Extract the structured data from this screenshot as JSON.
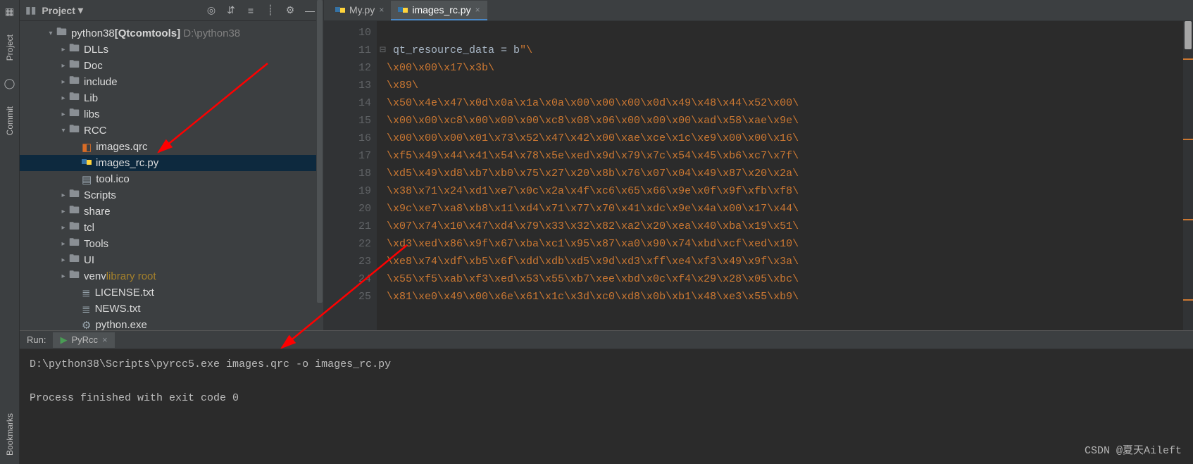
{
  "leftRail": {
    "project": "Project",
    "commit": "Commit",
    "bookmarks": "Bookmarks"
  },
  "toolbar": {
    "menuLabel": "Project",
    "icons": [
      "target-icon",
      "collapse-icon",
      "expand-icon",
      "divider",
      "settings-icon",
      "minimize-icon"
    ]
  },
  "project": {
    "root": {
      "name": "python38",
      "suffix": "[Qtcomtools]",
      "path": "D:\\python38"
    },
    "nodes": [
      {
        "indent": 1,
        "tw": "v",
        "kind": "folder",
        "name": "python38",
        "suffix": "[Qtcomtools]",
        "muted": "D:\\python38"
      },
      {
        "indent": 2,
        "tw": ">",
        "kind": "folder",
        "name": "DLLs"
      },
      {
        "indent": 2,
        "tw": ">",
        "kind": "folder",
        "name": "Doc"
      },
      {
        "indent": 2,
        "tw": ">",
        "kind": "folder",
        "name": "include"
      },
      {
        "indent": 2,
        "tw": ">",
        "kind": "folder",
        "name": "Lib"
      },
      {
        "indent": 2,
        "tw": ">",
        "kind": "folder",
        "name": "libs"
      },
      {
        "indent": 2,
        "tw": "v",
        "kind": "folder",
        "name": "RCC"
      },
      {
        "indent": 3,
        "tw": "",
        "kind": "qrc",
        "name": "images.qrc"
      },
      {
        "indent": 3,
        "tw": "",
        "kind": "py",
        "name": "images_rc.py",
        "selected": true
      },
      {
        "indent": 3,
        "tw": "",
        "kind": "ico",
        "name": "tool.ico"
      },
      {
        "indent": 2,
        "tw": ">",
        "kind": "folder",
        "name": "Scripts"
      },
      {
        "indent": 2,
        "tw": ">",
        "kind": "folder",
        "name": "share"
      },
      {
        "indent": 2,
        "tw": ">",
        "kind": "folder",
        "name": "tcl"
      },
      {
        "indent": 2,
        "tw": ">",
        "kind": "folder",
        "name": "Tools"
      },
      {
        "indent": 2,
        "tw": ">",
        "kind": "folder",
        "name": "UI"
      },
      {
        "indent": 2,
        "tw": ">",
        "kind": "folder",
        "name": "venv",
        "lib": "library root"
      },
      {
        "indent": 3,
        "tw": "",
        "kind": "txt",
        "name": "LICENSE.txt"
      },
      {
        "indent": 3,
        "tw": "",
        "kind": "txt",
        "name": "NEWS.txt"
      },
      {
        "indent": 3,
        "tw": "",
        "kind": "exe",
        "name": "python.exe"
      }
    ]
  },
  "tabs": [
    {
      "name": "My.py",
      "active": false
    },
    {
      "name": "images_rc.py",
      "active": true
    }
  ],
  "editor": {
    "startLine": 10,
    "lines": [
      {
        "n": 10,
        "text": ""
      },
      {
        "n": 11,
        "plain": "qt_resource_data = b",
        "str": "\"\\"
      },
      {
        "n": 12,
        "str": "\\x00\\x00\\x17\\x3b\\"
      },
      {
        "n": 13,
        "str": "\\x89\\"
      },
      {
        "n": 14,
        "str": "\\x50\\x4e\\x47\\x0d\\x0a\\x1a\\x0a\\x00\\x00\\x00\\x0d\\x49\\x48\\x44\\x52\\x00\\"
      },
      {
        "n": 15,
        "str": "\\x00\\x00\\xc8\\x00\\x00\\x00\\xc8\\x08\\x06\\x00\\x00\\x00\\xad\\x58\\xae\\x9e\\"
      },
      {
        "n": 16,
        "str": "\\x00\\x00\\x00\\x01\\x73\\x52\\x47\\x42\\x00\\xae\\xce\\x1c\\xe9\\x00\\x00\\x16\\"
      },
      {
        "n": 17,
        "str": "\\xf5\\x49\\x44\\x41\\x54\\x78\\x5e\\xed\\x9d\\x79\\x7c\\x54\\x45\\xb6\\xc7\\x7f\\"
      },
      {
        "n": 18,
        "str": "\\xd5\\x49\\xd8\\xb7\\xb0\\x75\\x27\\x20\\x8b\\x76\\x07\\x04\\x49\\x87\\x20\\x2a\\"
      },
      {
        "n": 19,
        "str": "\\x38\\x71\\x24\\xd1\\xe7\\x0c\\x2a\\x4f\\xc6\\x65\\x66\\x9e\\x0f\\x9f\\xfb\\xf8\\"
      },
      {
        "n": 20,
        "str": "\\x9c\\xe7\\xa8\\xb8\\x11\\xd4\\x71\\x77\\x70\\x41\\xdc\\x9e\\x4a\\x00\\x17\\x44\\"
      },
      {
        "n": 21,
        "str": "\\x07\\x74\\x10\\x47\\xd4\\x79\\x33\\x32\\x82\\xa2\\x20\\xea\\x40\\xba\\x19\\x51\\"
      },
      {
        "n": 22,
        "str": "\\xd3\\xed\\x86\\x9f\\x67\\xba\\xc1\\x95\\x87\\xa0\\x90\\x74\\xbd\\xcf\\xed\\x10\\"
      },
      {
        "n": 23,
        "str": "\\xe8\\x74\\xdf\\xb5\\x6f\\xdd\\xdb\\xd5\\x9d\\xd3\\xff\\xe4\\xf3\\x49\\x9f\\x3a\\"
      },
      {
        "n": 24,
        "str": "\\x55\\xf5\\xab\\xf3\\xed\\x53\\x55\\xb7\\xee\\xbd\\x0c\\xf4\\x29\\x28\\x05\\xbc\\"
      },
      {
        "n": 25,
        "str": "\\x81\\xe0\\x49\\x00\\x6e\\x61\\x1c\\x3d\\xc0\\xd8\\x0b\\xb1\\x48\\xe3\\x55\\xb9\\"
      }
    ]
  },
  "run": {
    "header": "Run:",
    "config": "PyRcc",
    "output1": "D:\\python38\\Scripts\\pyrcc5.exe images.qrc -o images_rc.py",
    "output2": "Process finished with exit code 0"
  },
  "watermark": "CSDN @夏天Aileft"
}
